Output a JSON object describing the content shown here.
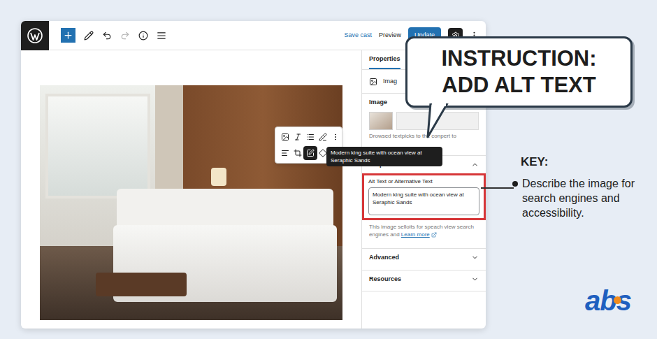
{
  "editor": {
    "header": {
      "save": "Save cast",
      "preview": "Preview",
      "update": "Update"
    },
    "block_toolbar": {
      "buttons": [
        {
          "selected": false
        },
        {
          "selected": false
        },
        {
          "selected": false
        },
        {
          "selected": false
        },
        {
          "selected": false
        },
        {
          "selected": false
        },
        {
          "selected": false
        },
        {
          "selected": true
        },
        {
          "selected": false
        }
      ],
      "tooltip": "Modern king suite with ocean view at Seraphic Sands"
    },
    "sidebar": {
      "tabs": [
        {
          "label": "Properties",
          "selected": true
        }
      ],
      "block": {
        "label": "Imag"
      },
      "sections": [
        {
          "kind": "image",
          "title": "Image",
          "expanded": true,
          "hint": "Drowsed textpicks to the conpert to"
        },
        {
          "kind": "alt",
          "title": "Properties",
          "expanded": true,
          "field_label": "Alt Text or Alternative Text",
          "value": "Modern king suite with ocean view at Seraphic Sands",
          "help": "This image selloits for speach view search engines and",
          "link": "Learn more"
        },
        {
          "kind": "collapsed",
          "title": "Advanced",
          "expanded": false
        },
        {
          "kind": "collapsed",
          "title": "Resources",
          "expanded": false
        }
      ]
    }
  },
  "callout": {
    "lines": [
      "INSTRUCTION:",
      "ADD ALT TEXT"
    ]
  },
  "key": {
    "title": "KEY:",
    "items": [
      "Describe the image for search engines and accessibility."
    ]
  },
  "logo": {
    "text": "abs"
  }
}
